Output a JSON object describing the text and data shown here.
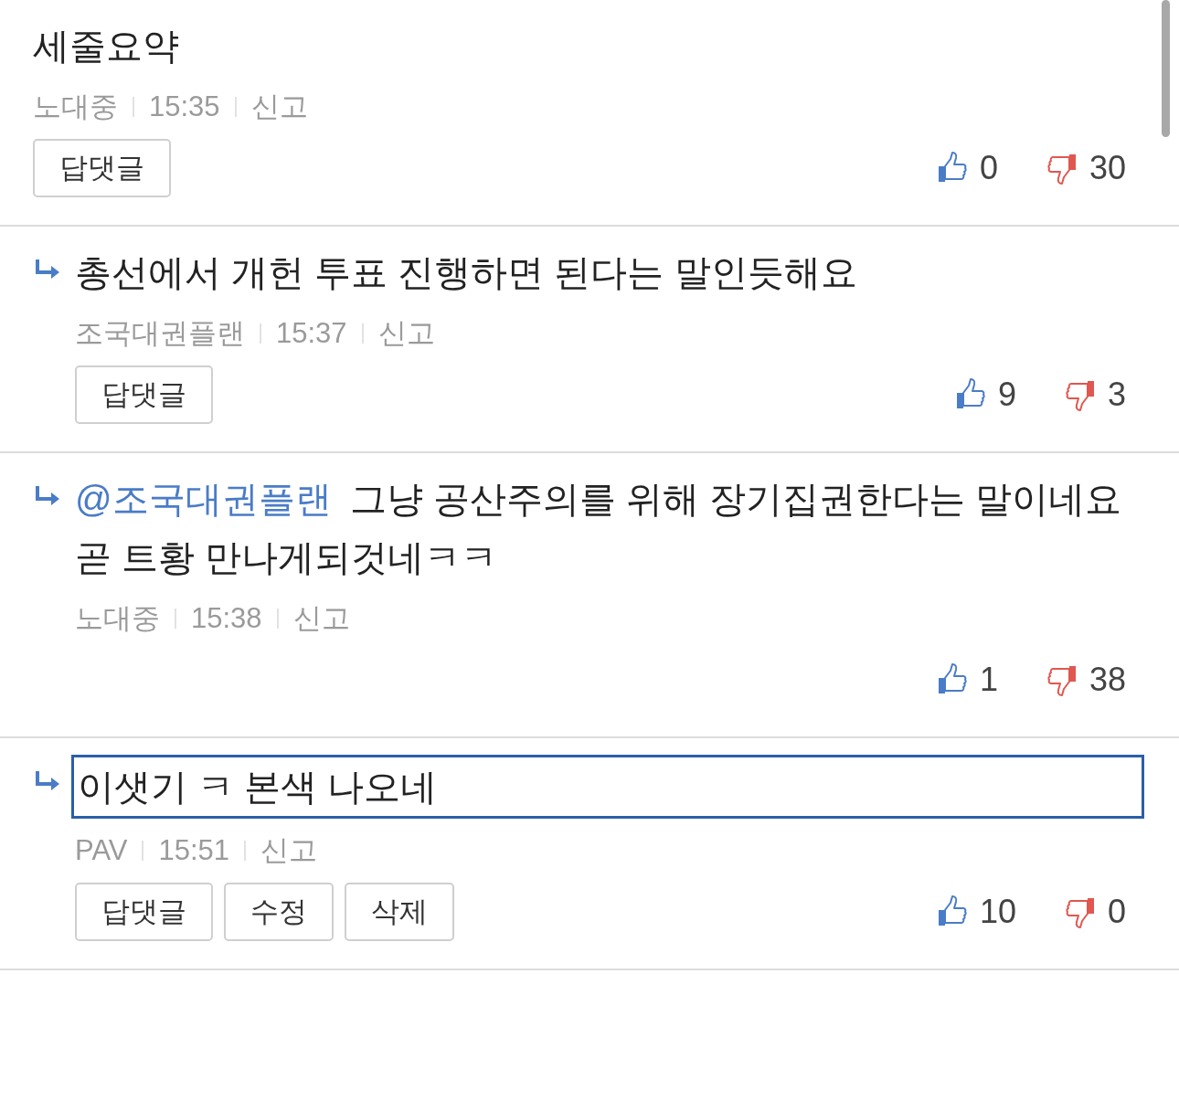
{
  "comments": [
    {
      "is_reply": false,
      "highlighted": false,
      "text": "세줄요약",
      "author": "노대중",
      "time": "15:35",
      "report": "신고",
      "buttons": [
        "답댓글"
      ],
      "likes": "0",
      "dislikes": "30"
    },
    {
      "is_reply": true,
      "highlighted": false,
      "text": "총선에서 개헌 투표 진행하면 된다는 말인듯해요",
      "author": "조국대권플랜",
      "time": "15:37",
      "report": "신고",
      "buttons": [
        "답댓글"
      ],
      "likes": "9",
      "dislikes": "3"
    },
    {
      "is_reply": true,
      "highlighted": false,
      "mention": "@조국대권플랜",
      "text": "그냥 공산주의를 위해 장기집권한다는 말이네요\n곧 트황 만나게되것네ㅋㅋ",
      "author": "노대중",
      "time": "15:38",
      "report": "신고",
      "likes": "1",
      "dislikes": "38"
    },
    {
      "is_reply": true,
      "highlighted": true,
      "text": "이샛기 ㅋ 본색 나오네",
      "author": "PAV",
      "time": "15:51",
      "report": "신고",
      "buttons": [
        "답댓글",
        "수정",
        "삭제"
      ],
      "likes": "10",
      "dislikes": "0"
    }
  ]
}
